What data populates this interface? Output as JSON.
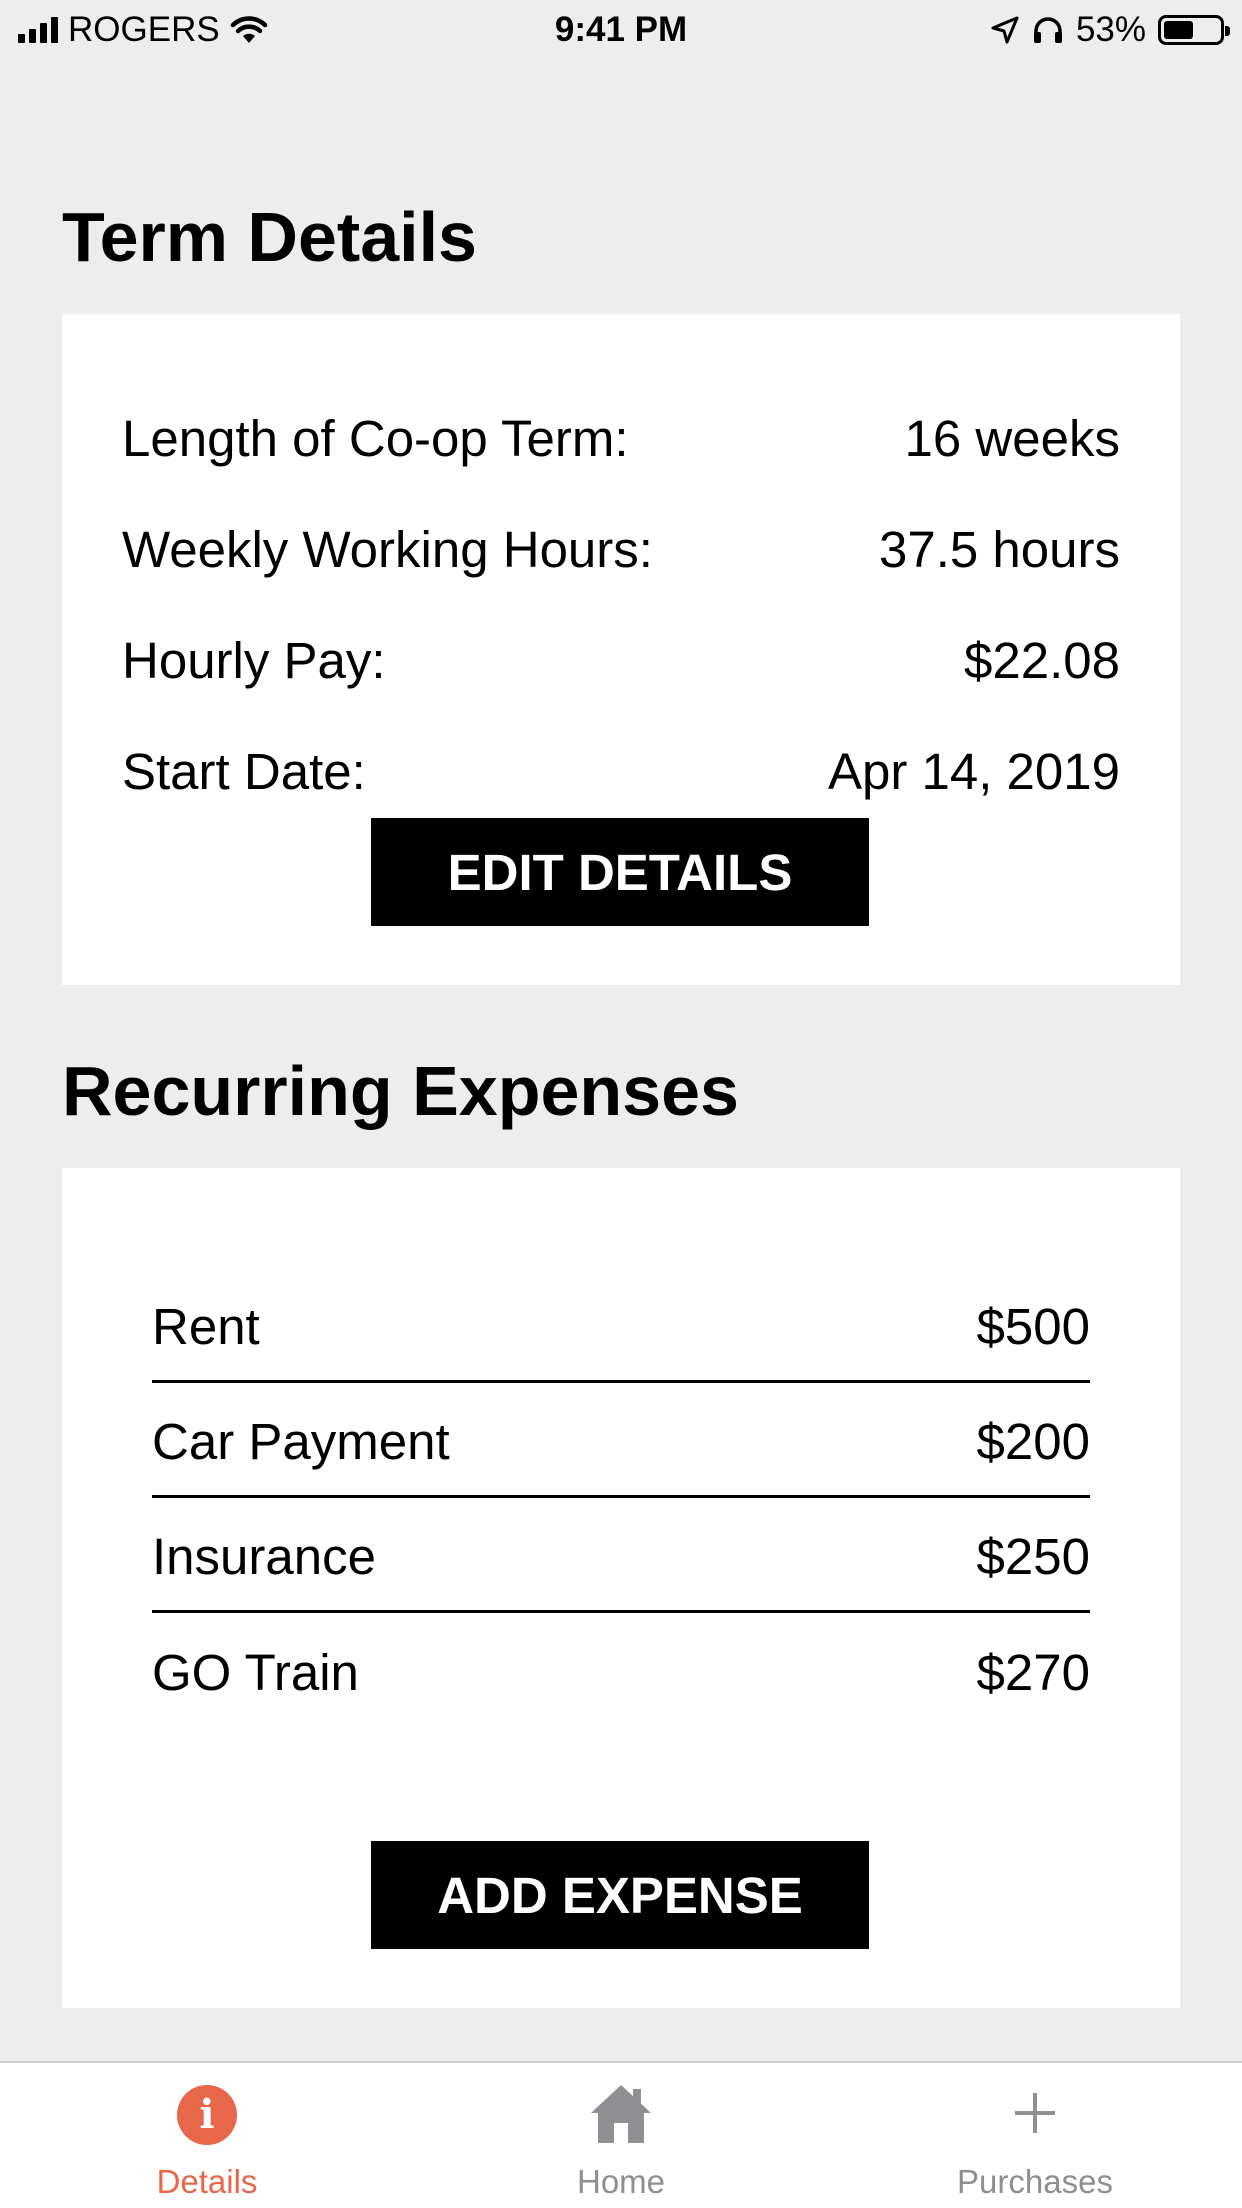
{
  "status_bar": {
    "carrier": "ROGERS",
    "time": "9:41 PM",
    "battery_percent": "53%",
    "battery_level": 0.53,
    "icons": [
      "signal-bars-icon",
      "wifi-icon",
      "location-arrow-icon",
      "headphones-icon",
      "battery-icon"
    ]
  },
  "term_details": {
    "title": "Term Details",
    "rows": [
      {
        "label": "Length of Co-op Term:",
        "value": "16 weeks"
      },
      {
        "label": "Weekly Working Hours:",
        "value": "37.5 hours"
      },
      {
        "label": "Hourly Pay:",
        "value": "$22.08"
      },
      {
        "label": "Start Date:",
        "value": "Apr 14, 2019"
      }
    ],
    "button_label": "EDIT DETAILS"
  },
  "recurring_expenses": {
    "title": "Recurring Expenses",
    "items": [
      {
        "name": "Rent",
        "amount": "$500"
      },
      {
        "name": "Car Payment",
        "amount": "$200"
      },
      {
        "name": "Insurance",
        "amount": "$250"
      },
      {
        "name": "GO Train",
        "amount": "$270"
      }
    ],
    "button_label": "ADD EXPENSE"
  },
  "tab_bar": {
    "active_color": "#e8674b",
    "inactive_color": "#8e8e93",
    "tabs": [
      {
        "label": "Details",
        "icon": "info-circle-icon",
        "active": true
      },
      {
        "label": "Home",
        "icon": "house-icon",
        "active": false
      },
      {
        "label": "Purchases",
        "icon": "plus-icon",
        "active": false
      }
    ]
  }
}
